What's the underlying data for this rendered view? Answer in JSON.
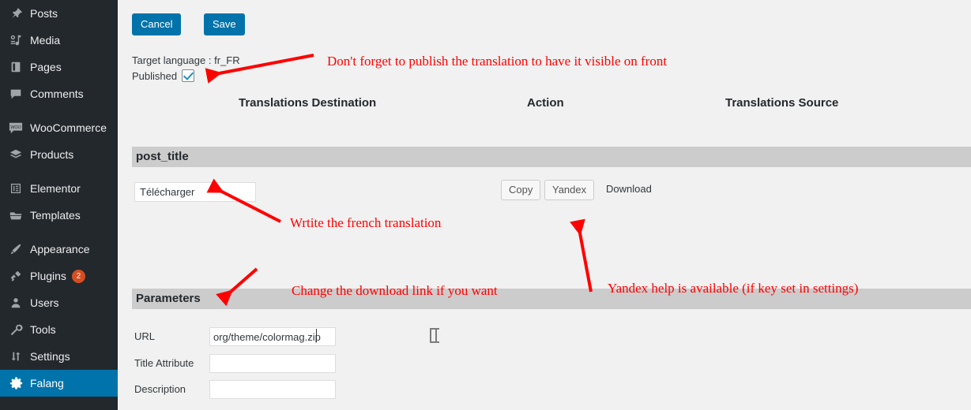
{
  "sidebar": {
    "items": [
      {
        "label": "Posts",
        "icon": "pin-icon",
        "type": "item"
      },
      {
        "label": "Media",
        "icon": "media-icon",
        "type": "item"
      },
      {
        "label": "Pages",
        "icon": "page-icon",
        "type": "item"
      },
      {
        "label": "Comments",
        "icon": "comment-icon",
        "type": "item"
      },
      {
        "label": "",
        "icon": "",
        "type": "separator"
      },
      {
        "label": "WooCommerce",
        "icon": "woo-icon",
        "type": "item"
      },
      {
        "label": "Products",
        "icon": "products-icon",
        "type": "item"
      },
      {
        "label": "",
        "icon": "",
        "type": "separator"
      },
      {
        "label": "Elementor",
        "icon": "elementor-icon",
        "type": "item"
      },
      {
        "label": "Templates",
        "icon": "templates-icon",
        "type": "item"
      },
      {
        "label": "",
        "icon": "",
        "type": "separator"
      },
      {
        "label": "Appearance",
        "icon": "brush-icon",
        "type": "item"
      },
      {
        "label": "Plugins",
        "icon": "plug-icon",
        "type": "item",
        "badge": "2"
      },
      {
        "label": "Users",
        "icon": "user-icon",
        "type": "item"
      },
      {
        "label": "Tools",
        "icon": "wrench-icon",
        "type": "item"
      },
      {
        "label": "Settings",
        "icon": "settings-icon",
        "type": "item"
      },
      {
        "label": "Falang",
        "icon": "gear-icon",
        "type": "item",
        "current": true
      }
    ],
    "active_color": "#0073aa",
    "background_color": "#23282d",
    "badge_color": "#d54e21"
  },
  "toolbar": {
    "cancel_label": "Cancel",
    "save_label": "Save",
    "button_color": "#0073aa"
  },
  "meta": {
    "target_language_label": "Target language : fr_FR",
    "published_label": "Published",
    "published_checked": true
  },
  "columns": {
    "destination": "Translations Destination",
    "action": "Action",
    "source": "Translations Source"
  },
  "sections": {
    "post_title": {
      "title": "post_title",
      "translation_value": "Télécharger",
      "copy_label": "Copy",
      "yandex_label": "Yandex",
      "source_text": "Download"
    },
    "parameters": {
      "title": "Parameters",
      "rows": [
        {
          "label": "URL",
          "value": "org/theme/colormag.zip"
        },
        {
          "label": "Title Attribute",
          "value": ""
        },
        {
          "label": "Description",
          "value": ""
        }
      ]
    }
  },
  "annotations": {
    "color": "#ff0000",
    "publish": "Don't forget to publish the translation to have it visible on front",
    "write": "Wrtite the french translation",
    "link": "Change the download link if you want",
    "yandex": "Yandex help is available (if key set in settings)"
  }
}
